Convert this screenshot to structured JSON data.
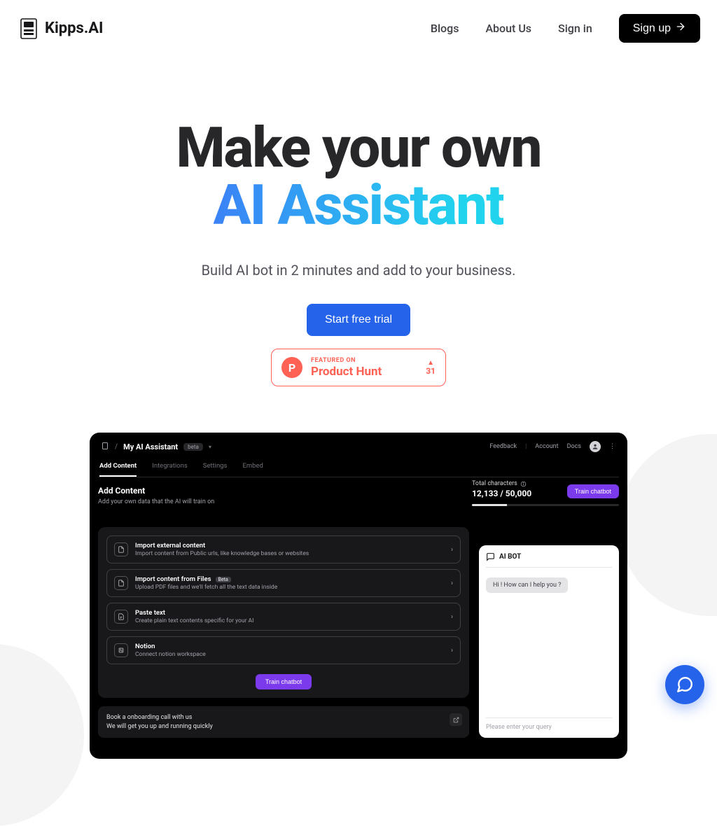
{
  "brand": "Kipps.AI",
  "nav": {
    "blogs": "Blogs",
    "about": "About Us",
    "signin": "Sign in",
    "signup": "Sign up"
  },
  "hero": {
    "line1": "Make your own",
    "line2": "AI Assistant",
    "sub": "Build AI bot in 2 minutes and add to your business.",
    "cta": "Start free trial"
  },
  "ph": {
    "featured": "FEATURED ON",
    "name": "Product Hunt",
    "count": "31",
    "letter": "P"
  },
  "preview": {
    "crumb_title": "My AI Assistant",
    "beta": "beta",
    "top_links": {
      "feedback": "Feedback",
      "account": "Account",
      "docs": "Docs"
    },
    "tabs": [
      "Add Content",
      "Integrations",
      "Settings",
      "Embed"
    ],
    "heading": "Add Content",
    "desc": "Add your own data that the AI will train on",
    "meta": {
      "label": "Total characters",
      "value": "12,133 / 50,000",
      "train": "Train chatbot"
    },
    "options": [
      {
        "t1": "Import external content",
        "t2": "Import content from Public urls, like knowledge bases or websites",
        "badge": ""
      },
      {
        "t1": "Import content from Files",
        "t2": "Upload PDF files and we'll fetch all the text data inside",
        "badge": "Beta"
      },
      {
        "t1": "Paste text",
        "t2": "Create plain text contents specific for your AI",
        "badge": ""
      },
      {
        "t1": "Notion",
        "t2": "Connect notion workspace",
        "badge": ""
      }
    ],
    "train2": "Train chatbot",
    "call1": "Book a onboarding call with us",
    "call2": "We will get you up and running quickly",
    "bot": {
      "title": "AI BOT",
      "msg": "Hi ! How can I help you ?",
      "placeholder": "Please enter your query"
    }
  }
}
